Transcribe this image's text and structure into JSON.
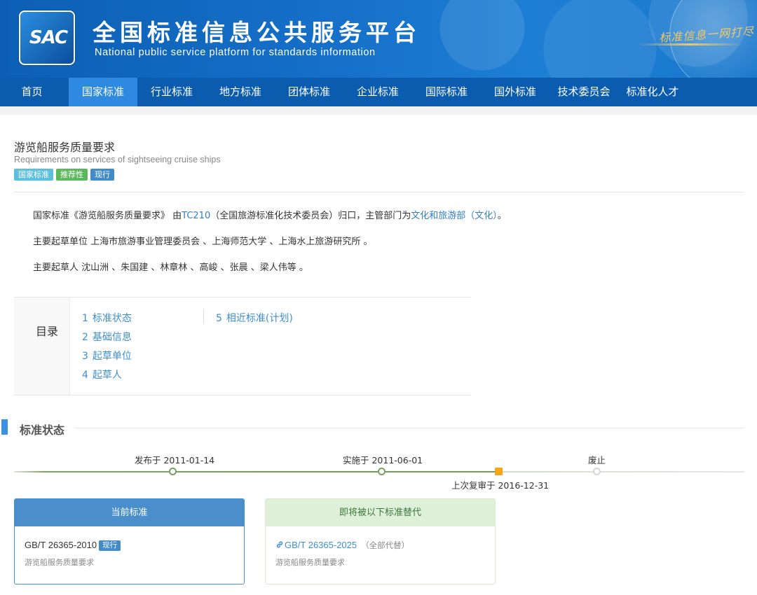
{
  "header": {
    "logo_text": "SAC",
    "title": "全国标准信息公共服务平台",
    "subtitle": "National public service platform  for standards information",
    "slogan": "标准信息一网打尽"
  },
  "nav": {
    "items": [
      "首页",
      "国家标准",
      "行业标准",
      "地方标准",
      "团体标准",
      "企业标准",
      "国际标准",
      "国外标准",
      "技术委员会",
      "标准化人才"
    ],
    "active": "国家标准"
  },
  "standard": {
    "title_zh": "游览船服务质量要求",
    "title_en": "Requirements on services of sightseeing cruise ships",
    "tags": [
      "国家标准",
      "推荐性",
      "现行"
    ]
  },
  "intro": {
    "p1_prefix": "国家标准《游览船服务质量要求》 由",
    "p1_tc": "TC210",
    "p1_mid": "（全国旅游标准化技术委员会）归口，主管部门为",
    "p1_dept": "文化和旅游部（文化）",
    "p1_suffix": "。",
    "p2": "主要起草单位 上海市旅游事业管理委员会 、上海师范大学 、上海水上旅游研究所 。",
    "p3": "主要起草人 沈山洲 、朱国建 、林章林 、高峻 、张晨 、梁人伟等 。"
  },
  "toc": {
    "heading": "目录",
    "items": [
      {
        "num": "1",
        "label": "标准状态"
      },
      {
        "num": "2",
        "label": "基础信息"
      },
      {
        "num": "3",
        "label": "起草单位"
      },
      {
        "num": "4",
        "label": "起草人"
      },
      {
        "num": "5",
        "label": "相近标准(计划)"
      }
    ]
  },
  "status_section": {
    "title": "标准状态",
    "timeline": {
      "published": "发布于 2011-01-14",
      "implemented": "实施于 2011-06-01",
      "last_review": "上次复审于 2016-12-31",
      "abolished": "废止"
    },
    "current": {
      "header": "当前标准",
      "code": "GB/T 26365-2010",
      "badge": "现行",
      "name": "游览船服务质量要求"
    },
    "replacement": {
      "header": "即将被以下标准替代",
      "code": "GB/T 26365-2025",
      "note": "（全部代替）",
      "name": "游览船服务质量要求"
    }
  },
  "colors": {
    "nav_bg": "#0b5cae",
    "nav_active": "#2e8ae0",
    "link": "#3d8fd1",
    "timeline_green": "#6e9f52",
    "timeline_review": "#f4a615"
  }
}
